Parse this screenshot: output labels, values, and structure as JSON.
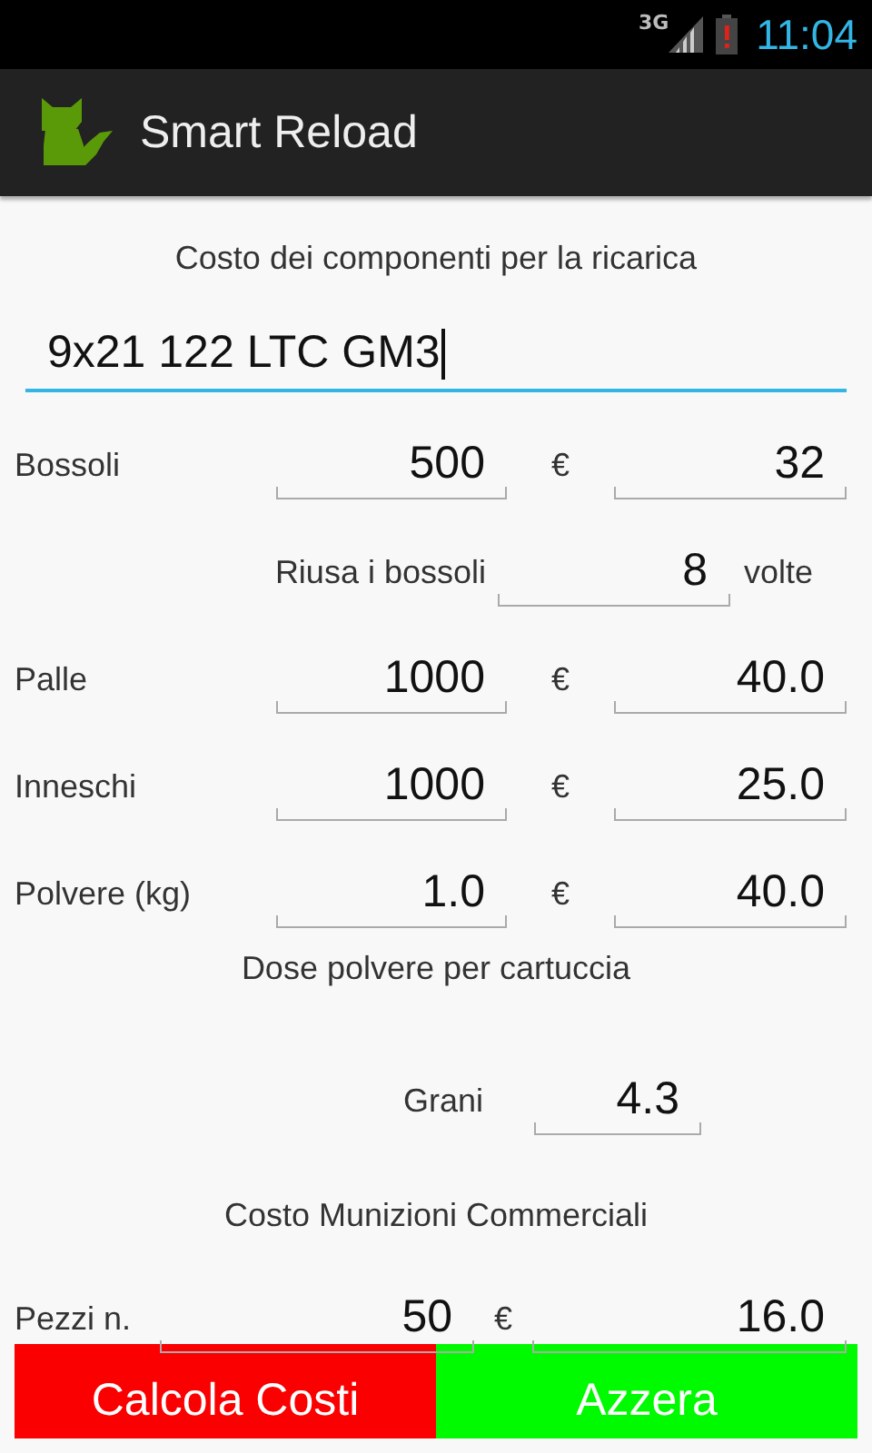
{
  "status_bar": {
    "network": "3G",
    "battery_low": true,
    "time": "11:04"
  },
  "app_bar": {
    "title": "Smart Reload"
  },
  "form": {
    "rows": [
      {
        "kind": "heading",
        "text": "Costo dei componenti per la ricarica"
      },
      {
        "kind": "name",
        "value": "9x21 122 LTC GM3",
        "focused": true
      },
      {
        "kind": "cost",
        "label": "Bossoli",
        "quantity": "500",
        "currency": "€",
        "price": "32"
      },
      {
        "kind": "reuse",
        "label": "Riusa i bossoli",
        "value": "8",
        "suffix": "volte"
      },
      {
        "kind": "cost",
        "label": "Palle",
        "quantity": "1000",
        "currency": "€",
        "price": "40.0"
      },
      {
        "kind": "cost",
        "label": "Inneschi",
        "quantity": "1000",
        "currency": "€",
        "price": "25.0"
      },
      {
        "kind": "cost",
        "label": "Polvere (kg)",
        "quantity": "1.0",
        "currency": "€",
        "price": "40.0"
      },
      {
        "kind": "heading",
        "text": "Dose polvere per cartuccia"
      },
      {
        "kind": "grains",
        "label": "Grani",
        "value": "4.3"
      },
      {
        "kind": "heading",
        "text": "Costo Munizioni Commerciali"
      },
      {
        "kind": "commercial",
        "label": "Pezzi n.",
        "quantity": "50",
        "currency": "€",
        "price": "16.0"
      }
    ]
  },
  "buttons": [
    {
      "label": "Calcola Costi",
      "color": "#fa0000"
    },
    {
      "label": "Azzera",
      "color": "#00fa00"
    }
  ]
}
